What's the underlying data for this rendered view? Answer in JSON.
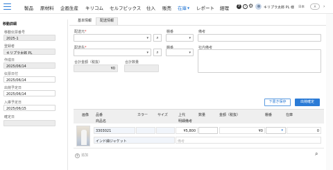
{
  "nav": {
    "items": [
      {
        "label": "製品",
        "active": false
      },
      {
        "label": "原材料",
        "active": false
      },
      {
        "label": "企画生産",
        "active": false
      },
      {
        "label": "キリコム",
        "active": false
      },
      {
        "label": "セルフピックス",
        "active": false
      },
      {
        "label": "仕入",
        "active": false
      },
      {
        "label": "販売",
        "active": false
      },
      {
        "label": "在庫",
        "active": true
      },
      {
        "label": "レポート",
        "active": false
      },
      {
        "label": "経理",
        "active": false
      }
    ],
    "user_name": "キリプラ太郎 PL 様",
    "lang": "日本",
    "lang_toggle": "A",
    "accent": "#2b7bd6"
  },
  "left_panel": {
    "title": "移動詳細",
    "fields": [
      {
        "label": "移動伝票番号",
        "value": "2025-1",
        "disabled": true
      },
      {
        "label": "登録者",
        "value": "キリプラ太郎 PL",
        "disabled": true
      },
      {
        "label": "作成日",
        "value": "2025/06/14",
        "disabled": true
      },
      {
        "label": "伝票日付",
        "value": "2025/06/14",
        "disabled": false
      },
      {
        "label": "出荷予定日",
        "value": "2025/06/14",
        "disabled": false
      },
      {
        "label": "入庫予定日",
        "value": "2025/06/15",
        "disabled": false
      },
      {
        "label": "確定日",
        "value": "",
        "disabled": true
      }
    ]
  },
  "tabs": [
    {
      "label": "基本情報",
      "active": false
    },
    {
      "label": "配送情報",
      "active": true
    }
  ],
  "form": {
    "from_label": "配送元",
    "from_required": "*",
    "to_label": "配送先",
    "to_required": "*",
    "shelf1_label": "棚番",
    "shelf2_label": "棚番",
    "remarks_label": "備考",
    "internal_remarks_label": "社内備考",
    "total_amount_label": "合計金額（税抜）",
    "total_amount_value": "¥0",
    "total_qty_label": "合計数量",
    "total_qty_value": ""
  },
  "actions": {
    "draft_save": "下書き保存",
    "confirm_ship": "出荷確定"
  },
  "table": {
    "headers_row1": [
      "画像",
      "品番",
      "カラー",
      "サイズ",
      "上代",
      "数量",
      "金額（税抜）",
      "棚番",
      "在庫"
    ],
    "headers_row2": [
      "商品名",
      "明細備考"
    ],
    "rows": [
      {
        "sku": "3303021",
        "name": "インド綿ジャケット",
        "price": "¥5,800",
        "qty": "",
        "amount": "¥0",
        "stock": "0",
        "note_placeholder": "備考"
      }
    ],
    "add_label": "追加"
  }
}
